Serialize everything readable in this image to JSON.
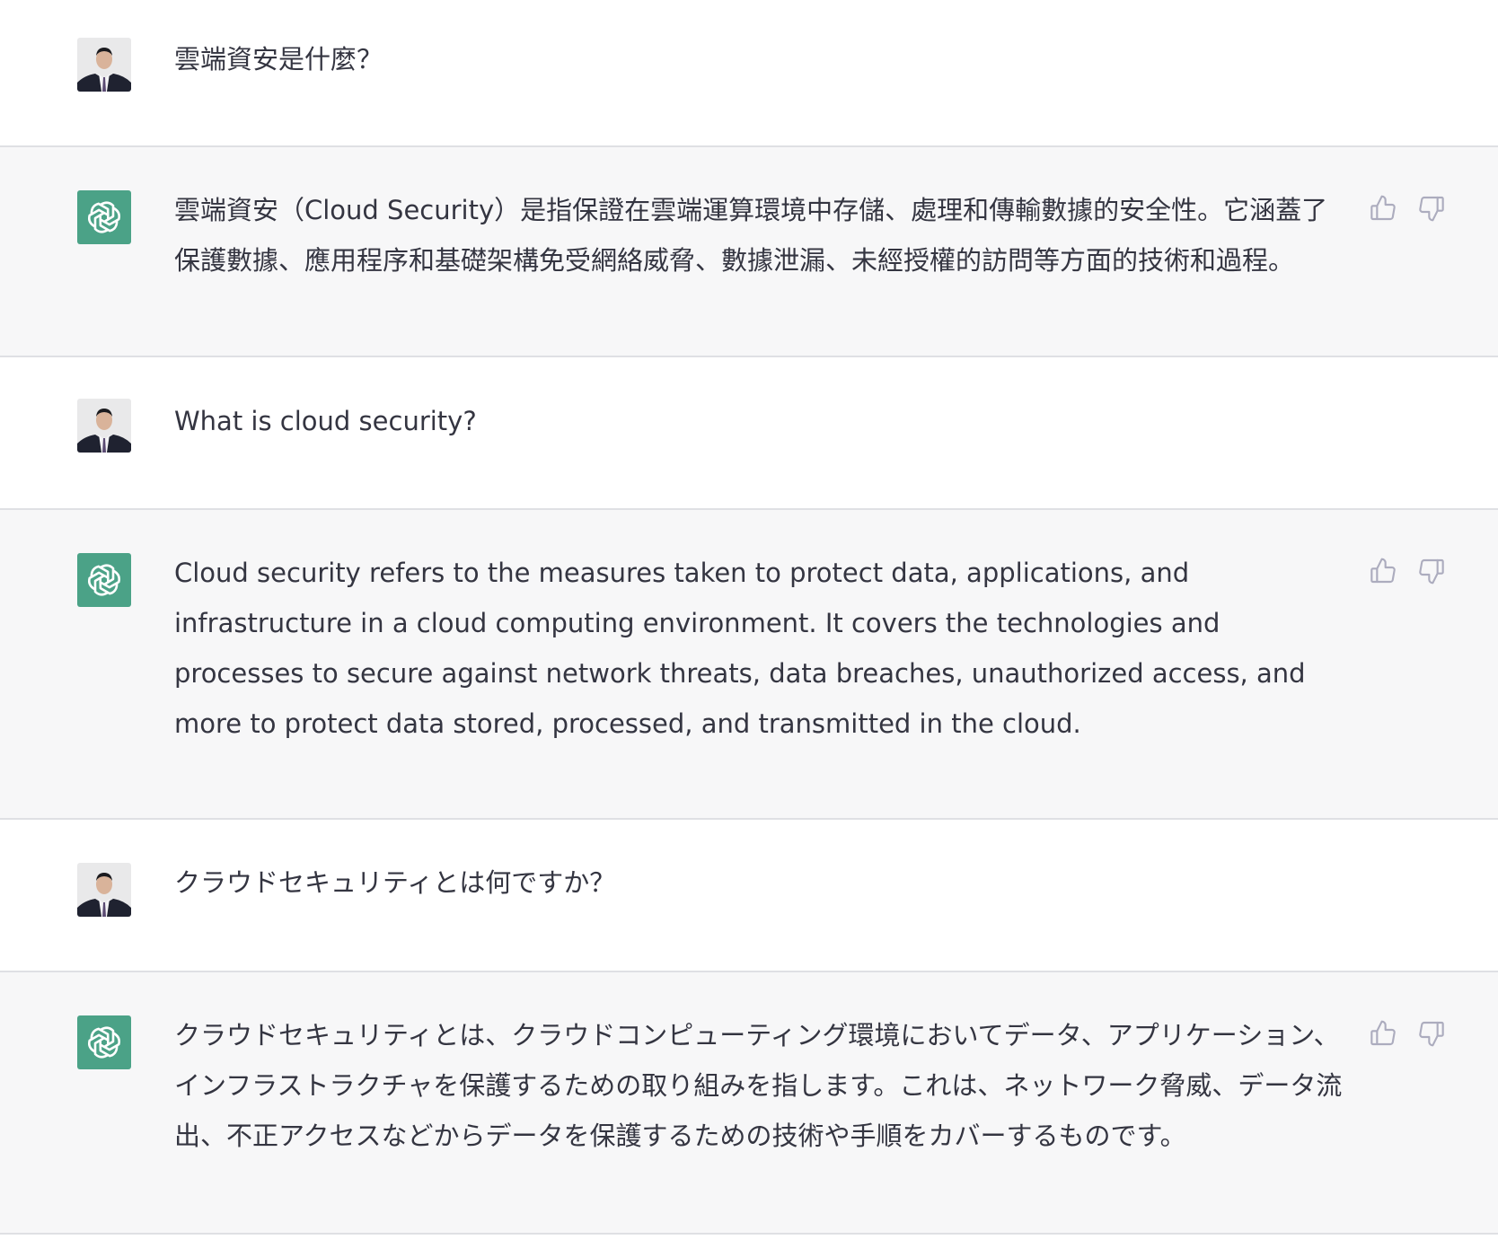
{
  "colors": {
    "assistant_bg": "#f7f7f8",
    "user_bg": "#ffffff",
    "assistant_avatar": "#4ba287",
    "text": "#343541",
    "icon": "#acacbe",
    "divider": "#dfe0e4"
  },
  "messages": [
    {
      "role": "user",
      "avatar_icon": "user-photo-avatar",
      "text": "雲端資安是什麼？"
    },
    {
      "role": "assistant",
      "avatar_icon": "openai-logo-icon",
      "text": "雲端資安（Cloud Security）是指保證在雲端運算環境中存儲、處理和傳輸數據的安全性。它涵蓋了保護數據、應用程序和基礎架構免受網絡威脅、數據泄漏、未經授權的訪問等方面的技術和過程。",
      "feedback_icons": [
        "thumbs-up-icon",
        "thumbs-down-icon"
      ]
    },
    {
      "role": "user",
      "avatar_icon": "user-photo-avatar",
      "text": "What is cloud security?"
    },
    {
      "role": "assistant",
      "avatar_icon": "openai-logo-icon",
      "text": "Cloud security refers to the measures taken to protect data, applications, and infrastructure in a cloud computing environment. It covers the technologies and processes to secure against network threats, data breaches, unauthorized access, and more to protect data stored, processed, and transmitted in the cloud.",
      "feedback_icons": [
        "thumbs-up-icon",
        "thumbs-down-icon"
      ]
    },
    {
      "role": "user",
      "avatar_icon": "user-photo-avatar",
      "text": "クラウドセキュリティとは何ですか？"
    },
    {
      "role": "assistant",
      "avatar_icon": "openai-logo-icon",
      "text": "クラウドセキュリティとは、クラウドコンピューティング環境においてデータ、アプリケーション、インフラストラクチャを保護するための取り組みを指します。これは、ネットワーク脅威、データ流出、不正アクセスなどからデータを保護するための技術や手順をカバーするものです。",
      "feedback_icons": [
        "thumbs-up-icon",
        "thumbs-down-icon"
      ]
    }
  ]
}
